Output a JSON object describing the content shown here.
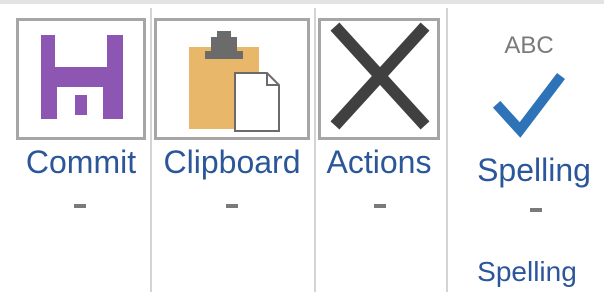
{
  "ribbon": {
    "buttons": [
      {
        "label": "Commit",
        "icon": "save-floppy-icon"
      },
      {
        "label": "Clipboard",
        "icon": "clipboard-paste-icon"
      },
      {
        "label": "Actions",
        "icon": "close-x-icon"
      },
      {
        "label": "Spelling",
        "icon": "spelling-check-icon",
        "icon_text": "ABC"
      }
    ],
    "group_label": "Spelling"
  },
  "colors": {
    "label_blue": "#2b579a",
    "save_purple": "#8e56b3",
    "clipboard_gold": "#e8b769",
    "x_gray": "#404040",
    "check_blue": "#2e72b8",
    "border_gray": "#a6a6a6"
  }
}
